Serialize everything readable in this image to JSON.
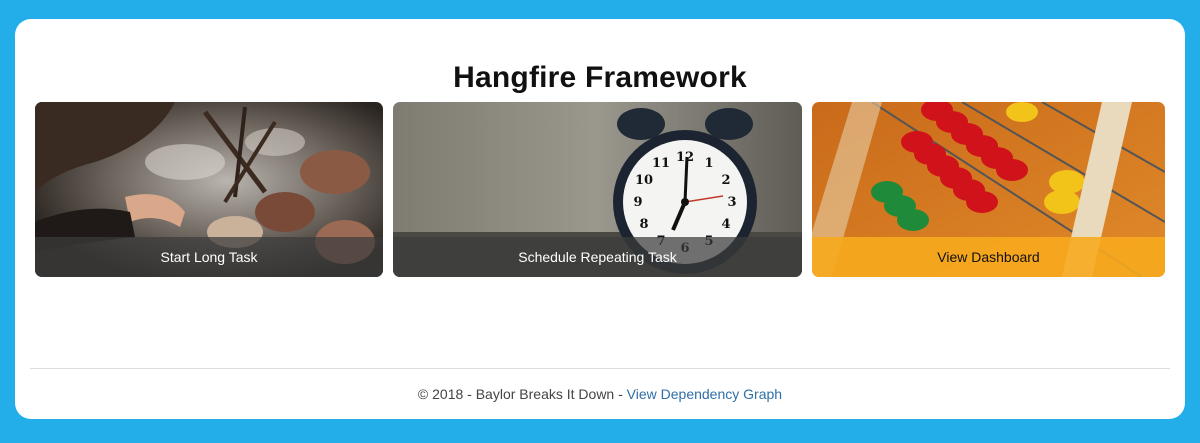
{
  "page": {
    "title": "Hangfire Framework"
  },
  "cards": [
    {
      "label": "Start Long Task",
      "image": "campfire-photo"
    },
    {
      "label": "Schedule Repeating Task",
      "image": "alarm-clock-photo"
    },
    {
      "label": "View Dashboard",
      "image": "abacus-photo"
    }
  ],
  "clock": {
    "numerals": [
      "12",
      "1",
      "2",
      "3",
      "4",
      "5",
      "6",
      "7",
      "8",
      "9",
      "10",
      "11"
    ]
  },
  "footer": {
    "text": "© 2018 - Baylor Breaks It Down - ",
    "link_label": "View Dependency Graph"
  },
  "colors": {
    "background": "#23aeea",
    "panel": "#ffffff",
    "caption_dark": "#3c3c3c",
    "caption_orange": "#f7aa1e",
    "link": "#2f6fa8"
  }
}
